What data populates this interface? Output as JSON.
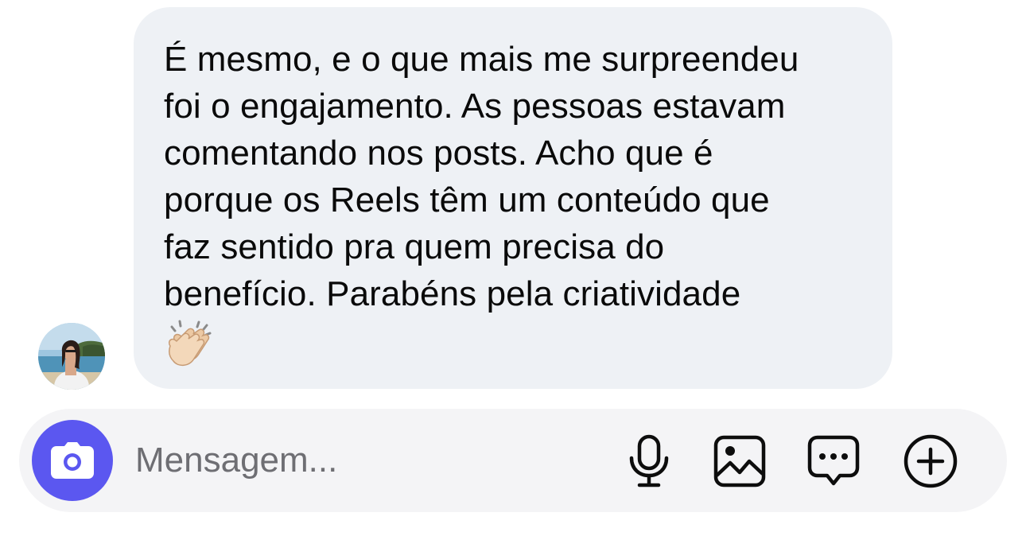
{
  "conversation": {
    "incoming_message": {
      "text": "É mesmo, e o que mais me surpreendeu\nfoi o engajamento. As pessoas estavam\ncomentando nos posts. Acho que é\nporque os Reels têm um conteúdo que\nfaz sentido pra quem precisa do\nbenefício. Parabéns pela criatividade",
      "emoji": "clapping-hands-light-skin-tone",
      "bubble_color": "#eef1f5"
    },
    "sender_avatar": "profile-photo-woman-beach"
  },
  "composer": {
    "placeholder": "Mensagem...",
    "value": "",
    "camera_button_color": "#5b57f0",
    "icons": [
      "camera-icon",
      "microphone-icon",
      "image-icon",
      "sticker-icon",
      "add-icon"
    ]
  }
}
